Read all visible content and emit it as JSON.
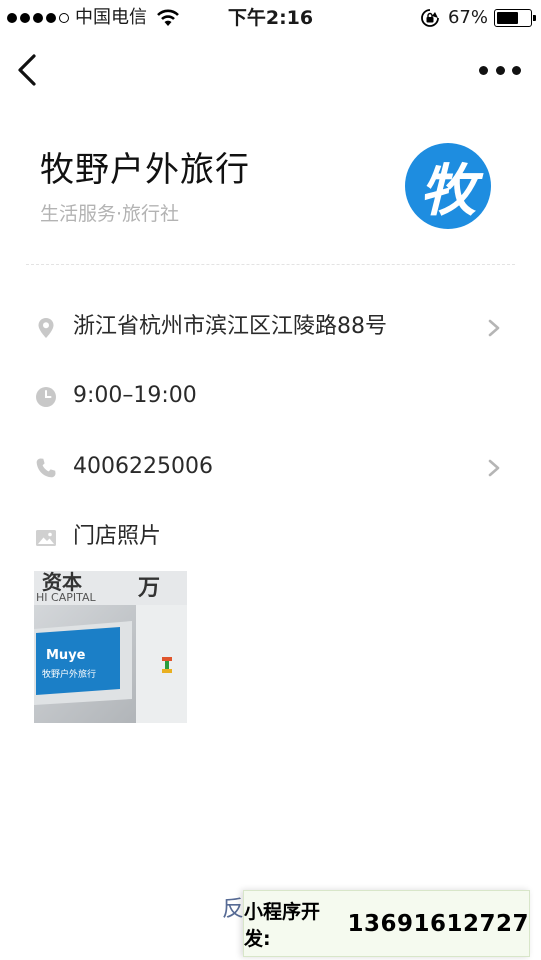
{
  "status_bar": {
    "carrier": "中国电信",
    "time": "下午2:16",
    "battery_percent": "67%",
    "battery_level": 0.67,
    "icons": [
      "signal-dots-icon",
      "wifi-icon",
      "orientation-lock-icon",
      "battery-icon"
    ]
  },
  "nav": {
    "back_icon": "chevron-left-icon",
    "more_icon": "more-dots-icon"
  },
  "store": {
    "name": "牧野户外旅行",
    "category": "生活服务·旅行社",
    "logo_char": "牧",
    "logo_color": "#1e8de0"
  },
  "info": {
    "address": "浙江省杭州市滨江区江陵路88号",
    "hours": "9:00–19:00",
    "phone": "4006225006",
    "photos_label": "门店照片"
  },
  "photo": {
    "text_top_left": "资本",
    "text_top_right": "万",
    "text_sub": "HI CAPITAL",
    "text_sign_1": "Muye",
    "text_sign_2": "牧野户外旅行"
  },
  "footer": {
    "feedback_partial": "反",
    "dev_label": "小程序开发:",
    "dev_phone": "13691612727"
  }
}
